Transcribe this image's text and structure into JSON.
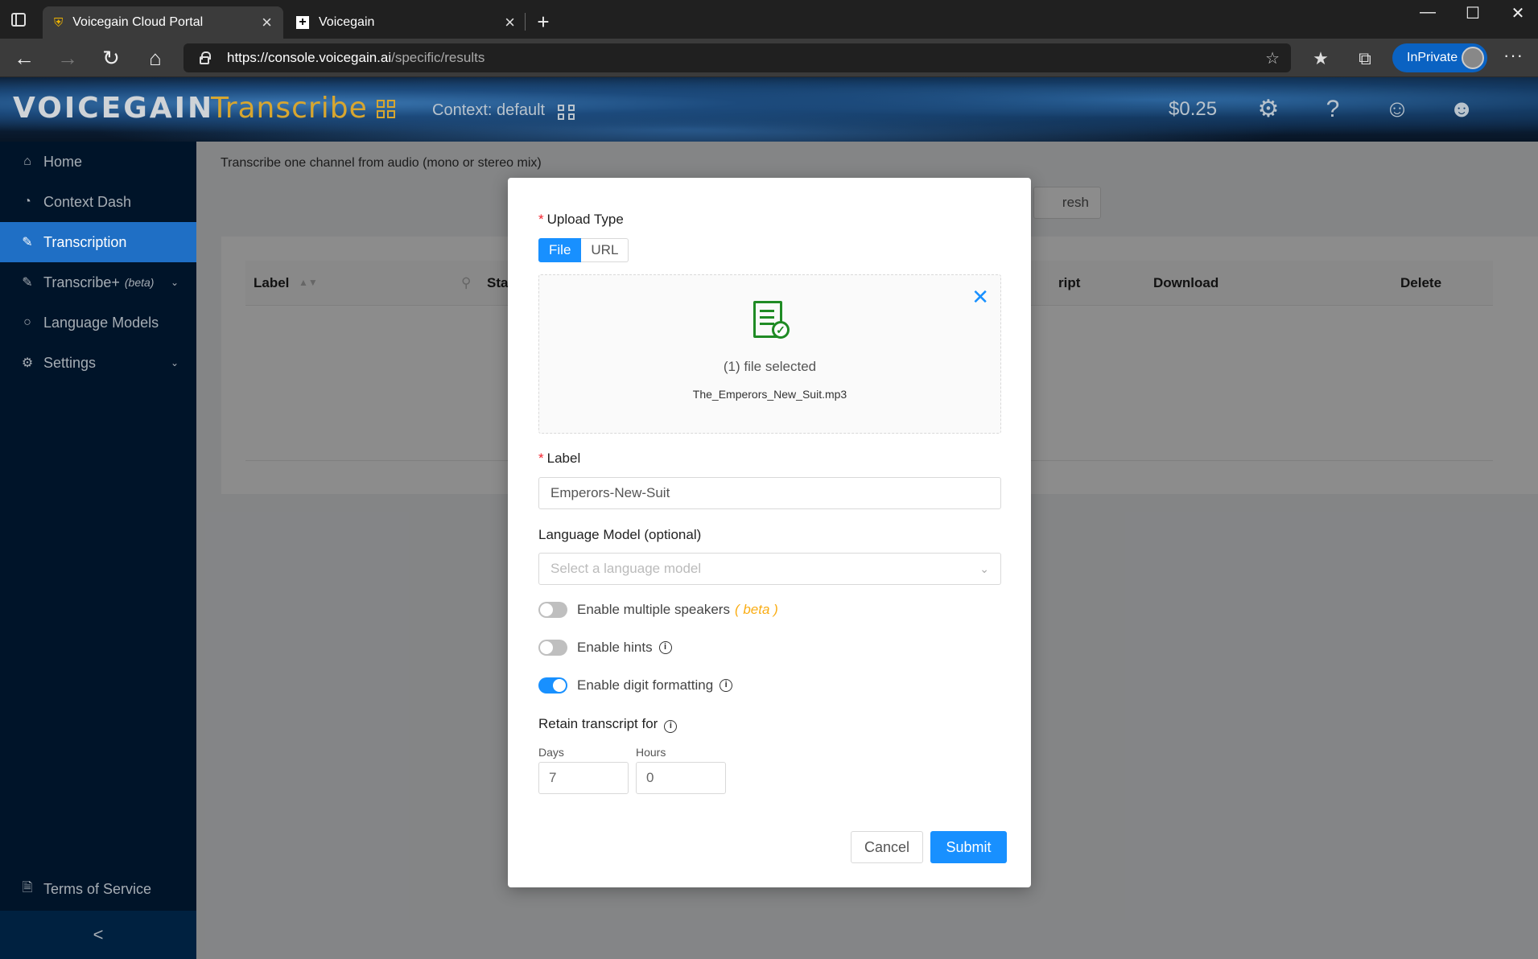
{
  "browser": {
    "tabs": [
      {
        "title": "Voicegain Cloud Portal",
        "active": true
      },
      {
        "title": "Voicegain",
        "active": false
      }
    ],
    "url": {
      "host": "https://console.voicegain.ai",
      "path": "/specific/results"
    },
    "inprivate_label": "InPrivate"
  },
  "header": {
    "brand_primary": "VOICEGAIN",
    "brand_product": "Transcribe",
    "context": "Context: default",
    "balance": "$0.25"
  },
  "sidebar": {
    "items": [
      {
        "label": "Home",
        "icon": "home-icon"
      },
      {
        "label": "Context Dash",
        "icon": "dashboard-icon"
      },
      {
        "label": "Transcription",
        "icon": "edit-icon",
        "active": true
      },
      {
        "label": "Transcribe+",
        "badge": "(beta)",
        "icon": "edit-icon"
      },
      {
        "label": "Language Models",
        "icon": "chat-icon"
      },
      {
        "label": "Settings",
        "icon": "gear-icon"
      }
    ],
    "footer": "Terms of Service",
    "collapse": "<"
  },
  "main": {
    "subtitle": "Transcribe one channel from audio (mono or stereo mix)",
    "refresh_partial": "resh",
    "columns": [
      "Label",
      "Star",
      "ript",
      "Download",
      "Delete"
    ]
  },
  "modal": {
    "upload_type_label": "Upload Type",
    "upload_options": [
      "File",
      "URL"
    ],
    "selected_option": "File",
    "file_count_text": "(1) file selected",
    "file_name": "The_Emperors_New_Suit.mp3",
    "label_label": "Label",
    "label_value": "Emperors-New-Suit",
    "lm_label": "Language Model (optional)",
    "lm_placeholder": "Select a language model",
    "toggles": [
      {
        "label": "Enable multiple speakers",
        "extra": "( beta )",
        "on": false
      },
      {
        "label": "Enable hints",
        "on": false,
        "info": true
      },
      {
        "label": "Enable digit formatting",
        "on": true,
        "info": true
      }
    ],
    "retain_label": "Retain transcript for",
    "days_label": "Days",
    "days_value": "7",
    "hours_label": "Hours",
    "hours_value": "0",
    "cancel": "Cancel",
    "submit": "Submit"
  },
  "colors": {
    "primary": "#1890ff",
    "sidebar": "#001429",
    "brand_gold": "#d7a630",
    "success": "#1f8b24"
  }
}
